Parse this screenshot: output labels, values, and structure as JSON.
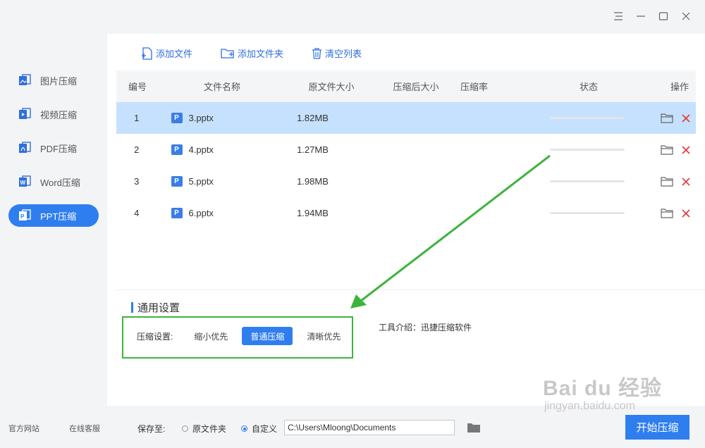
{
  "window": {
    "menu_icon": "menu-icon",
    "min_icon": "minimize-icon",
    "max_icon": "maximize-icon",
    "close_icon": "close-icon"
  },
  "sidebar": {
    "items": [
      {
        "label": "图片压缩",
        "icon": "image-icon",
        "active": false
      },
      {
        "label": "视频压缩",
        "icon": "video-icon",
        "active": false
      },
      {
        "label": "PDF压缩",
        "icon": "pdf-icon",
        "active": false
      },
      {
        "label": "Word压缩",
        "icon": "word-icon",
        "active": false
      },
      {
        "label": "PPT压缩",
        "icon": "ppt-icon",
        "active": true
      }
    ],
    "links": {
      "website": "官方网站",
      "support": "在线客服"
    }
  },
  "toolbar": {
    "add_file": "添加文件",
    "add_folder": "添加文件夹",
    "clear_list": "清空列表"
  },
  "table": {
    "headers": [
      "编号",
      "文件名称",
      "原文件大小",
      "压缩后大小",
      "压缩率",
      "状态",
      "操作"
    ],
    "rows": [
      {
        "no": "1",
        "type": "P",
        "name": "3.pptx",
        "size": "1.82MB",
        "compressed": "",
        "ratio": "",
        "progress": 0,
        "selected": true
      },
      {
        "no": "2",
        "type": "P",
        "name": "4.pptx",
        "size": "1.27MB",
        "compressed": "",
        "ratio": "",
        "progress": 0,
        "selected": false
      },
      {
        "no": "3",
        "type": "P",
        "name": "5.pptx",
        "size": "1.98MB",
        "compressed": "",
        "ratio": "",
        "progress": 0,
        "selected": false
      },
      {
        "no": "4",
        "type": "P",
        "name": "6.pptx",
        "size": "1.94MB",
        "compressed": "",
        "ratio": "",
        "progress": 0,
        "selected": false
      }
    ]
  },
  "settings": {
    "title": "通用设置",
    "compress_label": "压缩设置:",
    "modes": [
      {
        "label": "缩小优先",
        "active": false
      },
      {
        "label": "普通压缩",
        "active": true
      },
      {
        "label": "清晰优先",
        "active": false
      }
    ],
    "tool_intro": "工具介绍：迅捷压缩软件"
  },
  "footer": {
    "save_label": "保存至:",
    "radio_original": "原文件夹",
    "radio_custom": "自定义",
    "path": "C:\\Users\\Mloong\\Documents",
    "start_button": "开始压缩"
  },
  "watermark": {
    "line1": "Bai du 经验",
    "line2": "jingyan.baidu.com"
  },
  "colors": {
    "accent": "#2f7ef0",
    "annotation": "#3cb43c",
    "delete": "#e53935"
  }
}
